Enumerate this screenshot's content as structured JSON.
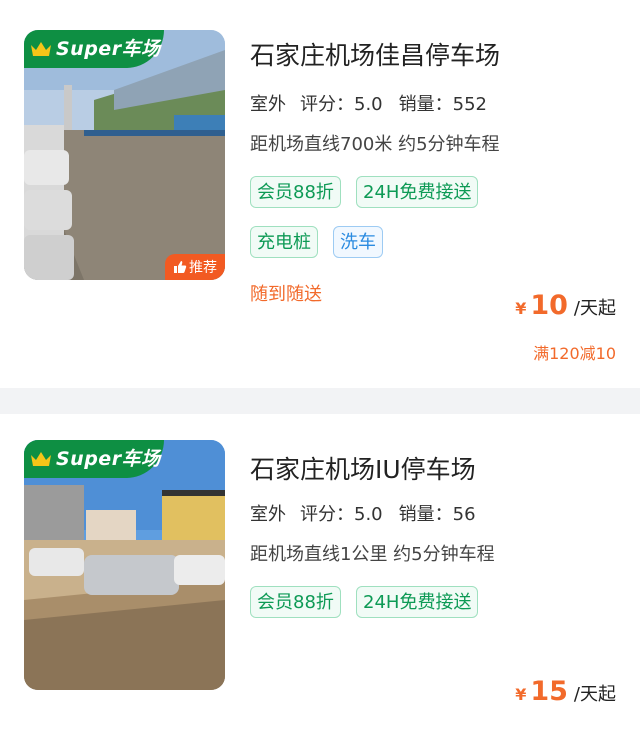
{
  "listings": [
    {
      "badge": "Super车场",
      "recommend": "推荐",
      "title": "石家庄机场佳昌停车场",
      "type": "室外",
      "rating": "评分：5.0",
      "sales": "销量：552",
      "distance": "距机场直线700米 约5分钟车程",
      "tags_row1": [
        "会员88折",
        "24H免费接送"
      ],
      "tags_row2": [
        "充电桩",
        "洗车"
      ],
      "promo": "随到随送",
      "price": {
        "currency": "¥",
        "amount": "10",
        "unit": "/天起"
      },
      "discount": "满120减10"
    },
    {
      "badge": "Super车场",
      "title": "石家庄机场IU停车场",
      "type": "室外",
      "rating": "评分：5.0",
      "sales": "销量：56",
      "distance": "距机场直线1公里 约5分钟车程",
      "tags_row1": [
        "会员88折",
        "24H免费接送"
      ],
      "price": {
        "currency": "¥",
        "amount": "15",
        "unit": "/天起"
      }
    }
  ],
  "colors": {
    "brand_green": "#0e8f43",
    "accent_orange": "#f26a2b",
    "tag_green": "#0d9a55",
    "tag_blue": "#2b8be0"
  }
}
